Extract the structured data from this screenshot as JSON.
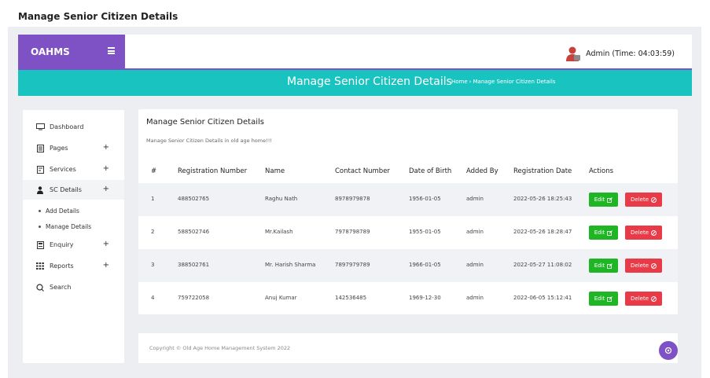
{
  "outer_title": "Manage Senior Citizen Details",
  "brand": {
    "name": "OAHMS"
  },
  "header": {
    "admin_label": "Admin (Time: 04:03:59)"
  },
  "banner": {
    "title": "Manage Senior Citizen Details",
    "breadcrumb": {
      "home": "Home",
      "separator": "›",
      "current": "Manage Senior Citizen Details"
    }
  },
  "sidebar": {
    "items": [
      {
        "label": "Dashboard",
        "icon": "monitor-icon",
        "expandable": false
      },
      {
        "label": "Pages",
        "icon": "page-icon",
        "expandable": true
      },
      {
        "label": "Services",
        "icon": "services-icon",
        "expandable": true
      },
      {
        "label": "SC Details",
        "icon": "person-icon",
        "expandable": true
      },
      {
        "label": "Enquiry",
        "icon": "enquiry-icon",
        "expandable": true
      },
      {
        "label": "Reports",
        "icon": "grid-icon",
        "expandable": true
      },
      {
        "label": "Search",
        "icon": "search-icon",
        "expandable": false
      }
    ],
    "sub_items": [
      "Add Details",
      "Manage Details"
    ],
    "plus": "+"
  },
  "card": {
    "title": "Manage Senior Citizen Details",
    "subtitle": "Manage Senior Citizen Details in old age home!!!"
  },
  "table": {
    "columns": [
      "#",
      "Registration Number",
      "Name",
      "Contact Number",
      "Date of Birth",
      "Added By",
      "Registration Date",
      "Actions"
    ],
    "rows": [
      {
        "num": "1",
        "reg": "488502765",
        "name": "Raghu Nath",
        "contact": "8978979878",
        "dob": "1956-01-05",
        "added_by": "admin",
        "reg_date": "2022-05-26 18:25:43"
      },
      {
        "num": "2",
        "reg": "588502746",
        "name": "Mr.Kailash",
        "contact": "7978798789",
        "dob": "1955-01-05",
        "added_by": "admin",
        "reg_date": "2022-05-26 18:28:47"
      },
      {
        "num": "3",
        "reg": "388502761",
        "name": "Mr. Harish Sharma",
        "contact": "7897979789",
        "dob": "1966-01-05",
        "added_by": "admin",
        "reg_date": "2022-05-27 11:08:02"
      },
      {
        "num": "4",
        "reg": "759722058",
        "name": "Anuj Kumar",
        "contact": "142536485",
        "dob": "1969-12-30",
        "added_by": "admin",
        "reg_date": "2022-06-05 15:12:41"
      }
    ],
    "edit_label": "Edit",
    "delete_label": "Delete"
  },
  "footer": {
    "text": "Copyright © Old Age Home Management System 2022"
  },
  "colors": {
    "brand": "#7e52c5",
    "banner": "#19c4c0",
    "edit": "#1fb524",
    "delete": "#e83a47"
  }
}
